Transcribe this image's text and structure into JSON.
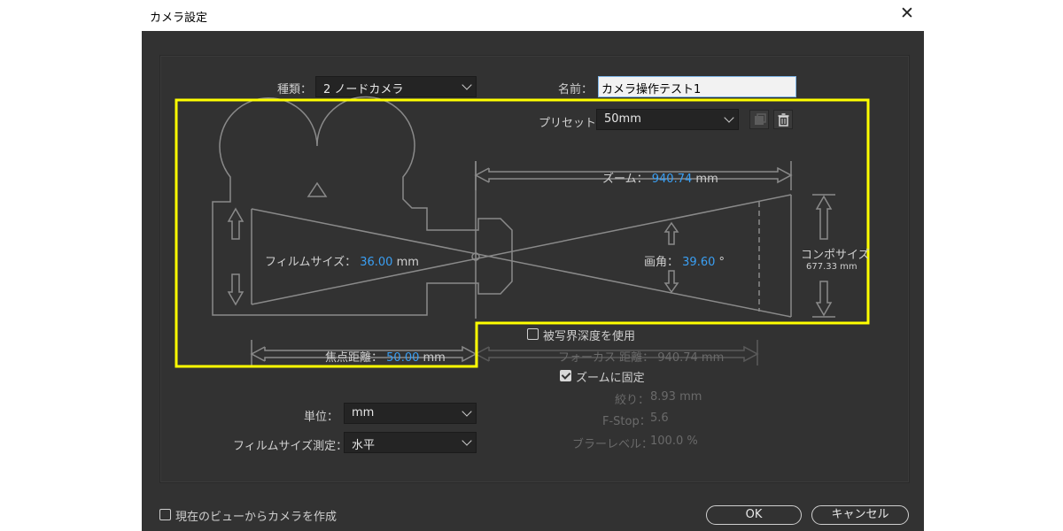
{
  "window": {
    "title": "カメラ設定",
    "close_glyph": "✕"
  },
  "type_field": {
    "label": "種類：",
    "value": "2 ノードカメラ"
  },
  "name_field": {
    "label": "名前：",
    "value": "カメラ操作テスト1"
  },
  "preset": {
    "label": "プリセット：",
    "value": "50mm",
    "save_icon": "save-preset-icon",
    "delete_icon": "trash-icon"
  },
  "diagram": {
    "zoom": {
      "label": "ズーム：",
      "value": "940.74",
      "unit": "mm"
    },
    "film_size": {
      "label": "フィルムサイズ：",
      "value": "36.00",
      "unit": "mm"
    },
    "angle": {
      "label": "画角：",
      "value": "39.60",
      "unit": "°"
    },
    "comp_size": {
      "label": "コンポサイズ",
      "value": "677.33 mm"
    },
    "focal_length": {
      "label": "焦点距離：",
      "value": "50.00",
      "unit": "mm"
    },
    "focus_distance": {
      "label": "フォーカス 距離：",
      "value": "940.74",
      "unit": "mm"
    }
  },
  "depth_of_field": {
    "label": "被写界深度を使用",
    "checked": false
  },
  "lock_zoom": {
    "label": "ズームに固定",
    "checked": true
  },
  "aperture": {
    "label": "絞り：",
    "value": "8.93 mm"
  },
  "fstop": {
    "label": "F-Stop：",
    "value": "5.6"
  },
  "blur_level": {
    "label": "ブラーレベル：",
    "value": "100.0 %"
  },
  "units": {
    "label": "単位：",
    "value": "mm"
  },
  "film_measure": {
    "label": "フィルムサイズ測定：",
    "value": "水平"
  },
  "footer": {
    "create_from_view": {
      "label": "現在のビューからカメラを作成",
      "checked": false
    },
    "ok": "OK",
    "cancel": "キャンセル"
  },
  "colors": {
    "highlight": "#ffff00",
    "accent": "#3a9ff3",
    "background": "#323232"
  }
}
